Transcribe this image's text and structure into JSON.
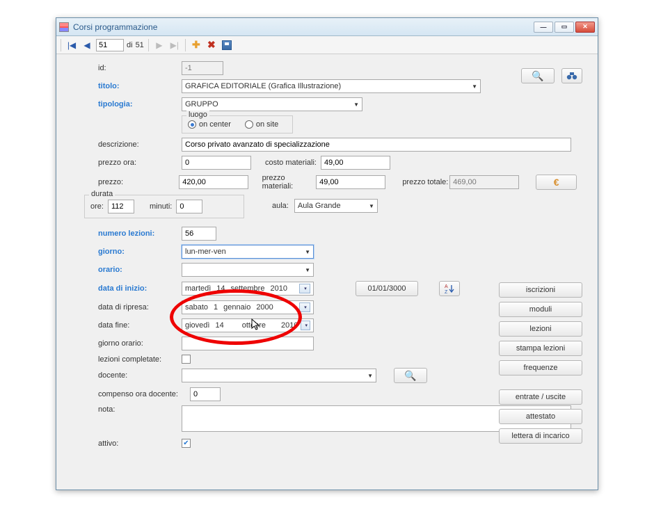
{
  "window": {
    "title": "Corsi programmazione"
  },
  "navigator": {
    "current": "51",
    "total_prefix": "di",
    "total": "51"
  },
  "form": {
    "id_label": "id:",
    "id_value": "-1",
    "titolo_label": "titolo:",
    "titolo_value": "GRAFICA EDITORIALE (Grafica Illustrazione)",
    "tipologia_label": "tipologia:",
    "tipologia_value": "GRUPPO",
    "luogo": {
      "legend": "luogo",
      "on_center": "on center",
      "on_site": "on site",
      "selected": "on_center"
    },
    "descrizione_label": "descrizione:",
    "descrizione_value": "Corso privato avanzato di specializzazione",
    "prezzo_ora_label": "prezzo ora:",
    "prezzo_ora_value": "0",
    "costo_materiali_label": "costo materiali:",
    "costo_materiali_value": "49,00",
    "prezzo_label": "prezzo:",
    "prezzo_value": "420,00",
    "prezzo_materiali_label": "prezzo materiali:",
    "prezzo_materiali_value": "49,00",
    "prezzo_totale_label": "prezzo totale:",
    "prezzo_totale_value": "469,00",
    "durata": {
      "legend": "durata",
      "ore_label": "ore:",
      "ore_value": "112",
      "minuti_label": "minuti:",
      "minuti_value": "0"
    },
    "aula_label": "aula:",
    "aula_value": "Aula Grande",
    "numero_lezioni_label": "numero lezioni:",
    "numero_lezioni_value": "56",
    "giorno_label": "giorno:",
    "giorno_value": "lun-mer-ven",
    "orario_label": "orario:",
    "orario_value": "",
    "data_inizio_label": "data di inizio:",
    "data_inizio_dow": "martedì",
    "data_inizio_day": "14",
    "data_inizio_month": "settembre",
    "data_inizio_year": "2010",
    "data_ripresa_label": "data di ripresa:",
    "data_ripresa_dow": "sabato",
    "data_ripresa_day": "1",
    "data_ripresa_month": "gennaio",
    "data_ripresa_year": "2000",
    "data_fine_label": "data fine:",
    "data_fine_dow": "giovedì",
    "data_fine_day": "14",
    "data_fine_month": "ottobre",
    "data_fine_year": "2010",
    "data_limit_button": "01/01/3000",
    "giorno_orario_label": "giorno orario:",
    "giorno_orario_value": "",
    "lezioni_completate_label": "lezioni completate:",
    "docente_label": "docente:",
    "docente_value": "",
    "compenso_label": "compenso ora docente:",
    "compenso_value": "0",
    "nota_label": "nota:",
    "attivo_label": "attivo:"
  },
  "buttons": {
    "iscrizioni": "iscrizioni",
    "moduli": "moduli",
    "lezioni": "lezioni",
    "stampa_lezioni": "stampa lezioni",
    "frequenze": "frequenze",
    "entrate_uscite": "entrate / uscite",
    "attestato": "attestato",
    "lettera_di_incarico": "lettera di incarico"
  },
  "icons": {
    "euro": "€",
    "find_all": "⛯",
    "az_sort": "A↓Z"
  }
}
